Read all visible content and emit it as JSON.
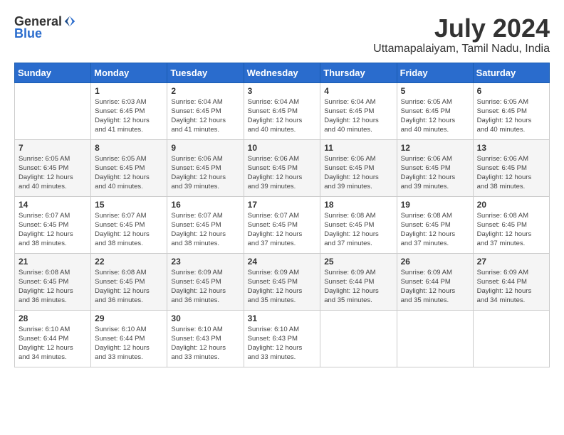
{
  "logo": {
    "general": "General",
    "blue": "Blue"
  },
  "title": "July 2024",
  "location": "Uttamapalaiyam, Tamil Nadu, India",
  "days_of_week": [
    "Sunday",
    "Monday",
    "Tuesday",
    "Wednesday",
    "Thursday",
    "Friday",
    "Saturday"
  ],
  "weeks": [
    [
      {
        "day": "",
        "info": ""
      },
      {
        "day": "1",
        "info": "Sunrise: 6:03 AM\nSunset: 6:45 PM\nDaylight: 12 hours\nand 41 minutes."
      },
      {
        "day": "2",
        "info": "Sunrise: 6:04 AM\nSunset: 6:45 PM\nDaylight: 12 hours\nand 41 minutes."
      },
      {
        "day": "3",
        "info": "Sunrise: 6:04 AM\nSunset: 6:45 PM\nDaylight: 12 hours\nand 40 minutes."
      },
      {
        "day": "4",
        "info": "Sunrise: 6:04 AM\nSunset: 6:45 PM\nDaylight: 12 hours\nand 40 minutes."
      },
      {
        "day": "5",
        "info": "Sunrise: 6:05 AM\nSunset: 6:45 PM\nDaylight: 12 hours\nand 40 minutes."
      },
      {
        "day": "6",
        "info": "Sunrise: 6:05 AM\nSunset: 6:45 PM\nDaylight: 12 hours\nand 40 minutes."
      }
    ],
    [
      {
        "day": "7",
        "info": "Sunrise: 6:05 AM\nSunset: 6:45 PM\nDaylight: 12 hours\nand 40 minutes."
      },
      {
        "day": "8",
        "info": "Sunrise: 6:05 AM\nSunset: 6:45 PM\nDaylight: 12 hours\nand 40 minutes."
      },
      {
        "day": "9",
        "info": "Sunrise: 6:06 AM\nSunset: 6:45 PM\nDaylight: 12 hours\nand 39 minutes."
      },
      {
        "day": "10",
        "info": "Sunrise: 6:06 AM\nSunset: 6:45 PM\nDaylight: 12 hours\nand 39 minutes."
      },
      {
        "day": "11",
        "info": "Sunrise: 6:06 AM\nSunset: 6:45 PM\nDaylight: 12 hours\nand 39 minutes."
      },
      {
        "day": "12",
        "info": "Sunrise: 6:06 AM\nSunset: 6:45 PM\nDaylight: 12 hours\nand 39 minutes."
      },
      {
        "day": "13",
        "info": "Sunrise: 6:06 AM\nSunset: 6:45 PM\nDaylight: 12 hours\nand 38 minutes."
      }
    ],
    [
      {
        "day": "14",
        "info": "Sunrise: 6:07 AM\nSunset: 6:45 PM\nDaylight: 12 hours\nand 38 minutes."
      },
      {
        "day": "15",
        "info": "Sunrise: 6:07 AM\nSunset: 6:45 PM\nDaylight: 12 hours\nand 38 minutes."
      },
      {
        "day": "16",
        "info": "Sunrise: 6:07 AM\nSunset: 6:45 PM\nDaylight: 12 hours\nand 38 minutes."
      },
      {
        "day": "17",
        "info": "Sunrise: 6:07 AM\nSunset: 6:45 PM\nDaylight: 12 hours\nand 37 minutes."
      },
      {
        "day": "18",
        "info": "Sunrise: 6:08 AM\nSunset: 6:45 PM\nDaylight: 12 hours\nand 37 minutes."
      },
      {
        "day": "19",
        "info": "Sunrise: 6:08 AM\nSunset: 6:45 PM\nDaylight: 12 hours\nand 37 minutes."
      },
      {
        "day": "20",
        "info": "Sunrise: 6:08 AM\nSunset: 6:45 PM\nDaylight: 12 hours\nand 37 minutes."
      }
    ],
    [
      {
        "day": "21",
        "info": "Sunrise: 6:08 AM\nSunset: 6:45 PM\nDaylight: 12 hours\nand 36 minutes."
      },
      {
        "day": "22",
        "info": "Sunrise: 6:08 AM\nSunset: 6:45 PM\nDaylight: 12 hours\nand 36 minutes."
      },
      {
        "day": "23",
        "info": "Sunrise: 6:09 AM\nSunset: 6:45 PM\nDaylight: 12 hours\nand 36 minutes."
      },
      {
        "day": "24",
        "info": "Sunrise: 6:09 AM\nSunset: 6:45 PM\nDaylight: 12 hours\nand 35 minutes."
      },
      {
        "day": "25",
        "info": "Sunrise: 6:09 AM\nSunset: 6:44 PM\nDaylight: 12 hours\nand 35 minutes."
      },
      {
        "day": "26",
        "info": "Sunrise: 6:09 AM\nSunset: 6:44 PM\nDaylight: 12 hours\nand 35 minutes."
      },
      {
        "day": "27",
        "info": "Sunrise: 6:09 AM\nSunset: 6:44 PM\nDaylight: 12 hours\nand 34 minutes."
      }
    ],
    [
      {
        "day": "28",
        "info": "Sunrise: 6:10 AM\nSunset: 6:44 PM\nDaylight: 12 hours\nand 34 minutes."
      },
      {
        "day": "29",
        "info": "Sunrise: 6:10 AM\nSunset: 6:44 PM\nDaylight: 12 hours\nand 33 minutes."
      },
      {
        "day": "30",
        "info": "Sunrise: 6:10 AM\nSunset: 6:43 PM\nDaylight: 12 hours\nand 33 minutes."
      },
      {
        "day": "31",
        "info": "Sunrise: 6:10 AM\nSunset: 6:43 PM\nDaylight: 12 hours\nand 33 minutes."
      },
      {
        "day": "",
        "info": ""
      },
      {
        "day": "",
        "info": ""
      },
      {
        "day": "",
        "info": ""
      }
    ]
  ]
}
